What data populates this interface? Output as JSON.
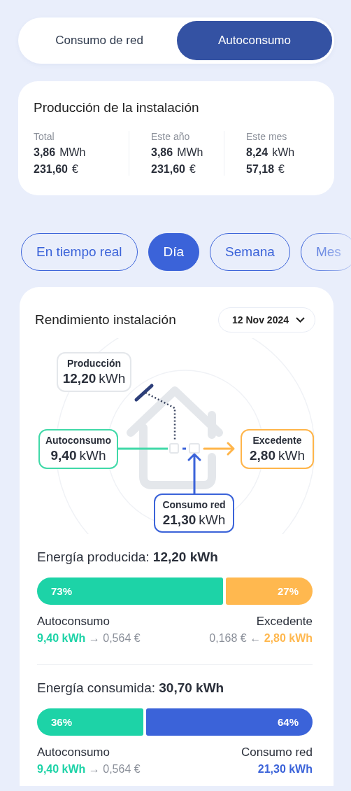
{
  "mode_toggle": [
    {
      "label": "Consumo de red",
      "selected": false
    },
    {
      "label": "Autoconsumo",
      "selected": true
    }
  ],
  "production": {
    "title": "Producción de la instalación",
    "columns": [
      {
        "label": "Total",
        "energy": "3,86",
        "energy_unit": "MWh",
        "money": "231,60",
        "money_unit": "€"
      },
      {
        "label": "Este año",
        "energy": "3,86",
        "energy_unit": "MWh",
        "money": "231,60",
        "money_unit": "€"
      },
      {
        "label": "Este mes",
        "energy": "8,24",
        "energy_unit": "kWh",
        "money": "57,18",
        "money_unit": "€"
      }
    ]
  },
  "periods": [
    {
      "label": "En tiempo real",
      "selected": false
    },
    {
      "label": "Día",
      "selected": true
    },
    {
      "label": "Semana",
      "selected": false
    },
    {
      "label": "Mes",
      "selected": false
    }
  ],
  "performance": {
    "title": "Rendimiento instalación",
    "date": "12 Nov 2024",
    "flow": [
      {
        "kind": "production",
        "label": "Producción",
        "value": "12,20",
        "unit": "kWh",
        "color": "#e4e7eb"
      },
      {
        "kind": "self",
        "label": "Autoconsumo",
        "value": "9,40",
        "unit": "kWh",
        "color": "#40d9a8"
      },
      {
        "kind": "surplus",
        "label": "Excedente",
        "value": "2,80",
        "unit": "kWh",
        "color": "#ffb54a"
      },
      {
        "kind": "grid",
        "label": "Consumo red",
        "value": "21,30",
        "unit": "kWh",
        "color": "#3b63d9"
      }
    ]
  },
  "summaries": [
    {
      "title": "Energía producida: **12,20 kWh**",
      "segments": [
        {
          "percent": "73%",
          "color": "#1dd3a7"
        },
        {
          "percent": "27%",
          "color": "#ffb84f"
        }
      ],
      "left": {
        "label": "Autoconsumo",
        "value": "9,40 kWh",
        "detail": "→ 0,564 €"
      },
      "right": {
        "label": "Excedente",
        "detail": "0,168 € ←",
        "value": "2,80 kWh"
      }
    },
    {
      "title": "Energía consumida: **30,70 kWh**",
      "segments": [
        {
          "percent": "36%",
          "color": "#1dd3a7"
        },
        {
          "percent": "64%",
          "color": "#3b63d9"
        }
      ],
      "left": {
        "label": "Autoconsumo",
        "value": "9,40 kWh",
        "detail": "→ 0,564 €"
      },
      "right": {
        "label": "Consumo red",
        "value": "21,30 kWh"
      }
    }
  ]
}
